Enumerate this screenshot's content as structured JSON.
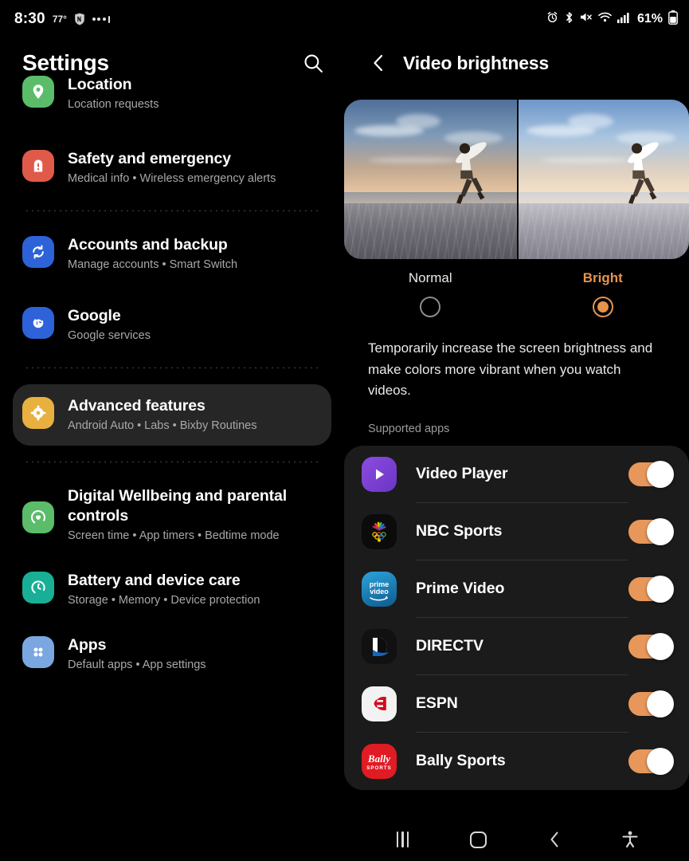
{
  "status_bar": {
    "time": "8:30",
    "temperature": "77°",
    "weather_icon": "nfl-shield-icon",
    "overflow_icon": "more-notifications-icon",
    "battery_percent": "61%",
    "icons": [
      "alarm-icon",
      "bluetooth-icon",
      "mute-icon",
      "wifi-icon",
      "signal-icon",
      "battery-icon"
    ]
  },
  "sidebar": {
    "title": "Settings",
    "search_icon": "search-icon",
    "items": [
      {
        "title": "Location",
        "subtitle": "Location requests",
        "icon": "location-pin-icon",
        "icon_color": "#5BBC6A",
        "selected": false,
        "clipped": true
      },
      {
        "title": "Safety and emergency",
        "subtitle": "Medical info  •  Wireless emergency alerts",
        "icon": "safety-emergency-icon",
        "icon_color": "#E05A4A",
        "selected": false
      },
      {
        "title": "Accounts and backup",
        "subtitle": "Manage accounts  •  Smart Switch",
        "icon": "sync-accounts-icon",
        "icon_color": "#2D62D8",
        "selected": false
      },
      {
        "title": "Google",
        "subtitle": "Google services",
        "icon": "google-g-icon",
        "icon_color": "#2D62D8",
        "selected": false
      },
      {
        "title": "Advanced features",
        "subtitle": "Android Auto  •  Labs  •  Bixby Routines",
        "icon": "advanced-features-gear-icon",
        "icon_color": "#E8B13F",
        "selected": true
      },
      {
        "title": "Digital Wellbeing and parental controls",
        "subtitle": "Screen time  •  App timers  •  Bedtime mode",
        "icon": "digital-wellbeing-icon",
        "icon_color": "#5BBC6A",
        "selected": false
      },
      {
        "title": "Battery and device care",
        "subtitle": "Storage  •  Memory  •  Device protection",
        "icon": "battery-device-care-icon",
        "icon_color": "#18AF96",
        "selected": false
      },
      {
        "title": "Apps",
        "subtitle": "Default apps  •  App settings",
        "icon": "apps-grid-icon",
        "icon_color": "#7BA7E0",
        "selected": false
      }
    ]
  },
  "detail": {
    "back_icon": "back-chevron-icon",
    "title": "Video brightness",
    "preview_alt": "surfer-running-on-beach-comparison",
    "modes": [
      {
        "label": "Normal",
        "selected": false
      },
      {
        "label": "Bright",
        "selected": true
      }
    ],
    "description": "Temporarily increase the screen brightness and make colors more vibrant when you watch videos.",
    "supported_apps_label": "Supported apps",
    "apps": [
      {
        "name": "Video Player",
        "icon": "video-player-icon",
        "enabled": true
      },
      {
        "name": "NBC Sports",
        "icon": "nbc-sports-icon",
        "enabled": true
      },
      {
        "name": "Prime Video",
        "icon": "prime-video-icon",
        "enabled": true
      },
      {
        "name": "DIRECTV",
        "icon": "directv-icon",
        "enabled": true
      },
      {
        "name": "ESPN",
        "icon": "espn-icon",
        "enabled": true
      },
      {
        "name": "Bally Sports",
        "icon": "bally-sports-icon",
        "enabled": true
      }
    ]
  },
  "nav_bar": {
    "recents_icon": "recents-icon",
    "home_icon": "home-icon",
    "back_icon": "back-icon",
    "accessibility_icon": "accessibility-icon"
  },
  "colors": {
    "accent_orange": "#E8934E",
    "toggle_on": "#E8975A",
    "background": "#000000",
    "card": "#1B1B1B",
    "selected_row": "#262626"
  }
}
